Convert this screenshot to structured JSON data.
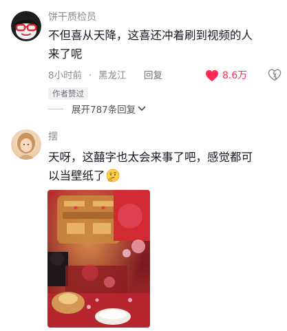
{
  "comments": [
    {
      "username": "饼干质检员",
      "text_line1": "不但喜从天降，这喜还冲着刷到视频的人",
      "text_line2": "来了呢",
      "time": "8小时前",
      "separator": "·",
      "location": "黑龙江",
      "reply_label": "回复",
      "like_count": "8.6万",
      "badge": "作者赞过",
      "expand_label": "展开787条回复",
      "avatar_icon": "red-glasses-avatar",
      "like_icon": "heart-filled-icon",
      "dislike_icon": "broken-heart-icon"
    },
    {
      "username": "摆",
      "text_line1": "天呀，这囍字也太会来事了吧，感觉都可",
      "text_line2": "以当壁纸了",
      "emoji": "thinking-face-emoji",
      "image_icon": "double-happiness-photo"
    }
  ],
  "colors": {
    "like": "#fe2c55",
    "muted": "#8a8b91",
    "text": "#161823",
    "badge_bg": "#f1f1f2"
  }
}
